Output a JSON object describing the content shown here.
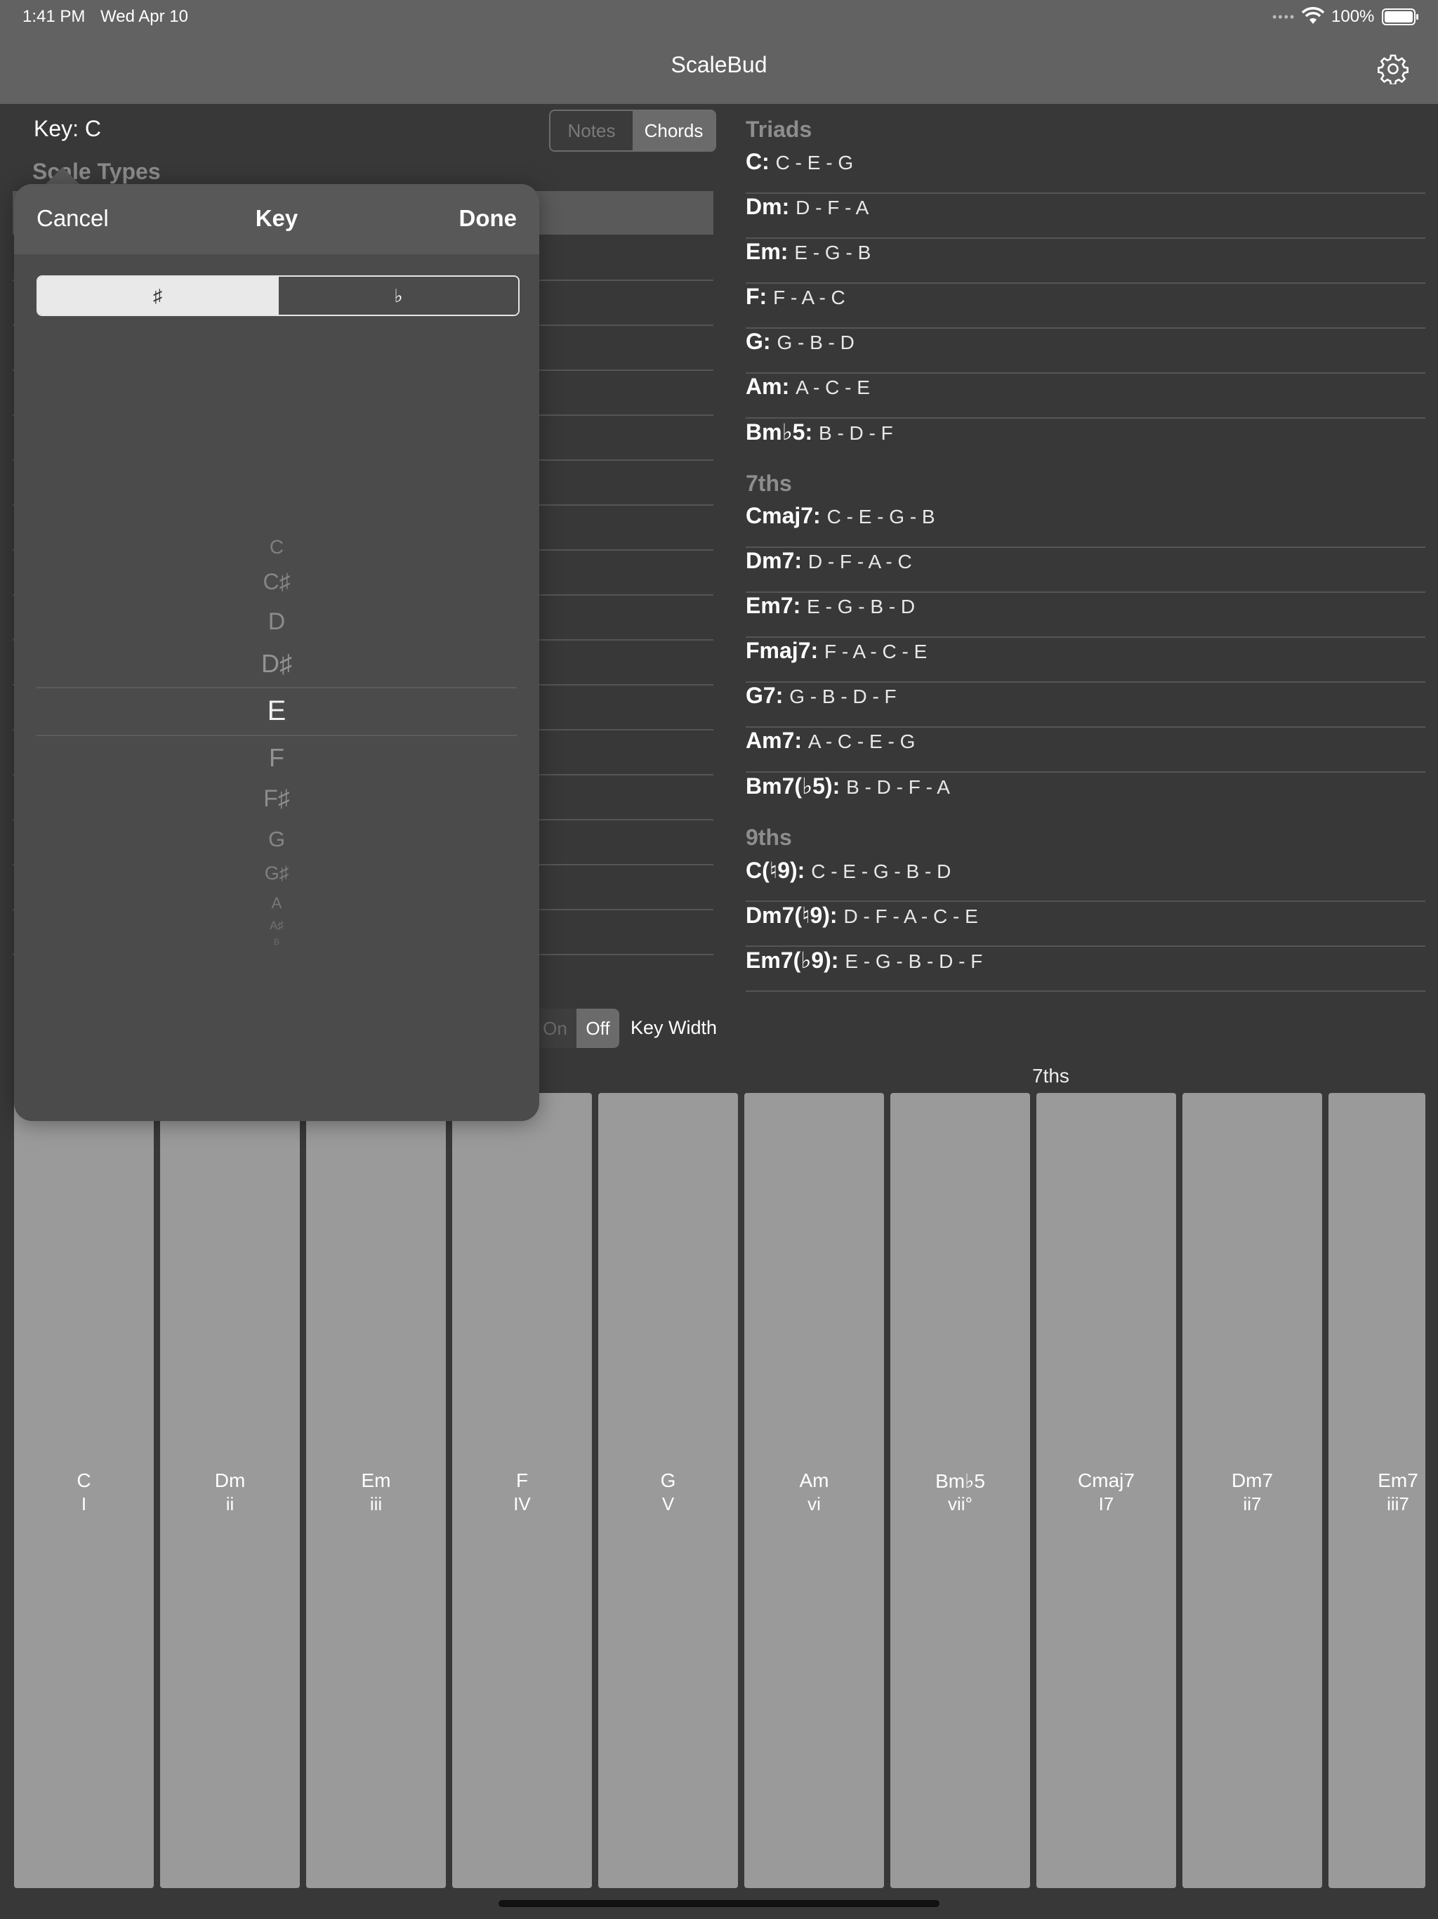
{
  "status": {
    "time": "1:41 PM",
    "date": "Wed Apr 10",
    "battery": "100%"
  },
  "nav": {
    "title": "ScaleBud",
    "settings_icon": "gear-icon"
  },
  "left": {
    "key_label": "Key: C",
    "mode": {
      "notes": "Notes",
      "chords": "Chords",
      "selected": "Chords"
    },
    "scale_types_header": "Scale Types",
    "show": {
      "on": "On",
      "off": "Off",
      "selected": "Off"
    },
    "key_width_label": "Key Width"
  },
  "chords": {
    "triads_header": "Triads",
    "triads": [
      {
        "name": "C:",
        "notes": "C - E - G"
      },
      {
        "name": "Dm:",
        "notes": "D - F - A"
      },
      {
        "name": "Em:",
        "notes": "E - G - B"
      },
      {
        "name": "F:",
        "notes": "F - A - C"
      },
      {
        "name": "G:",
        "notes": "G - B - D"
      },
      {
        "name": "Am:",
        "notes": "A - C - E"
      },
      {
        "name": "Bm♭5:",
        "notes": "B - D - F"
      }
    ],
    "sevenths_header": "7ths",
    "sevenths": [
      {
        "name": "Cmaj7:",
        "notes": "C - E - G - B"
      },
      {
        "name": "Dm7:",
        "notes": "D - F - A - C"
      },
      {
        "name": "Em7:",
        "notes": "E - G - B - D"
      },
      {
        "name": "Fmaj7:",
        "notes": "F - A - C - E"
      },
      {
        "name": "G7:",
        "notes": "G - B - D - F"
      },
      {
        "name": "Am7:",
        "notes": "A - C - E - G"
      },
      {
        "name": "Bm7(♭5):",
        "notes": "B - D - F - A"
      }
    ],
    "ninths_header": "9ths",
    "ninths": [
      {
        "name": "C(♮9):",
        "notes": "C - E - G - B - D"
      },
      {
        "name": "Dm7(♮9):",
        "notes": "D - F - A - C - E"
      },
      {
        "name": "Em7(♭9):",
        "notes": "E - G - B - D - F"
      }
    ]
  },
  "keyboard": {
    "section_label": "7ths",
    "keys": [
      {
        "name": "C",
        "roman": "I"
      },
      {
        "name": "Dm",
        "roman": "ii"
      },
      {
        "name": "Em",
        "roman": "iii"
      },
      {
        "name": "F",
        "roman": "IV"
      },
      {
        "name": "G",
        "roman": "V"
      },
      {
        "name": "Am",
        "roman": "vi"
      },
      {
        "name": "Bm♭5",
        "roman": "vii°"
      },
      {
        "name": "Cmaj7",
        "roman": "I7"
      },
      {
        "name": "Dm7",
        "roman": "ii7"
      },
      {
        "name": "Em7",
        "roman": "iii7"
      }
    ]
  },
  "popover": {
    "cancel": "Cancel",
    "title": "Key",
    "done": "Done",
    "accidentals": {
      "sharp": "♯",
      "flat": "♭",
      "selected": "♯"
    },
    "picker": [
      "C",
      "C♯",
      "D",
      "D♯",
      "E",
      "F",
      "F♯",
      "G",
      "G♯",
      "A",
      "A♯",
      "B"
    ],
    "selected": "E"
  }
}
